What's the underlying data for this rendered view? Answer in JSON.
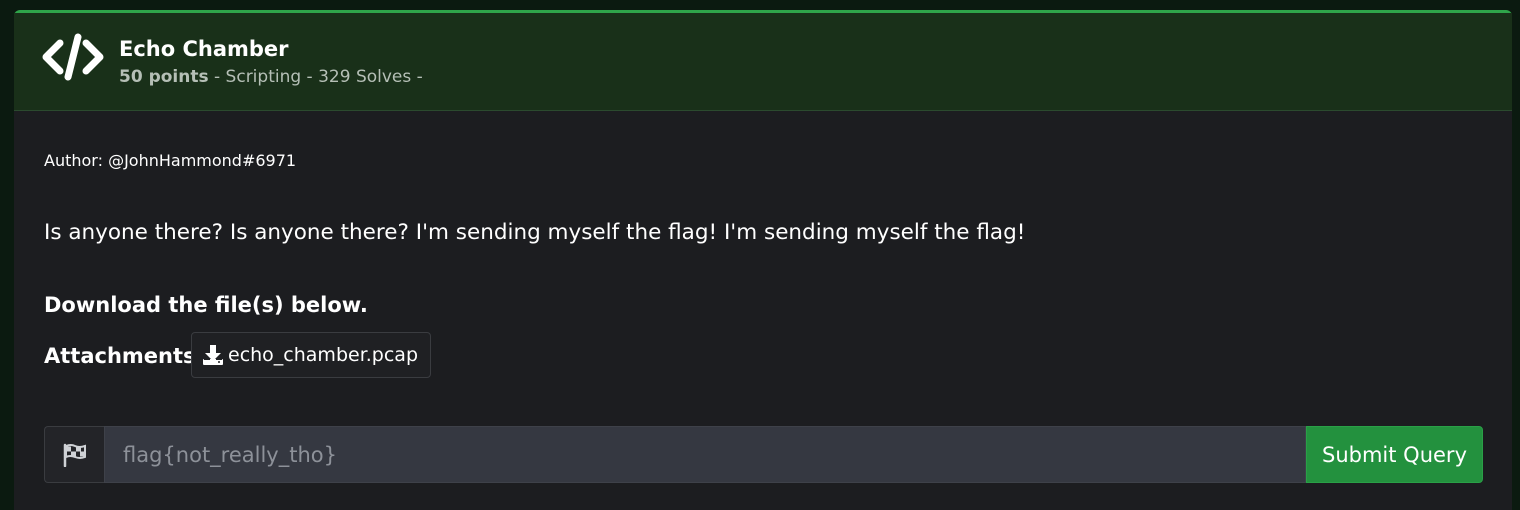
{
  "challenge": {
    "title": "Echo Chamber",
    "points": "50 points",
    "meta_rest": " - Scripting - 329 Solves -",
    "author": "Author: @JohnHammond#6971",
    "description": "Is anyone there? Is anyone there? I'm sending myself the flag! I'm sending myself the flag!",
    "download_text": "Download the file(s) below.",
    "attachments_label": "Attachments:",
    "attachment_file": "echo_chamber.pcap"
  },
  "flag_form": {
    "placeholder": "flag{not_really_tho}",
    "submit_label": "Submit Query"
  },
  "colors": {
    "accent": "#2fa44a",
    "header_bg": "#193019",
    "card_bg": "#1c1d20",
    "submit_bg": "#23913e"
  },
  "icons": {
    "header": "code-icon",
    "attachment": "download-icon",
    "flag_addon": "checkered-flag-icon"
  }
}
